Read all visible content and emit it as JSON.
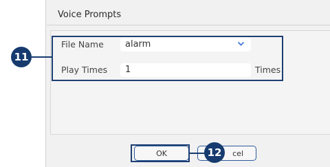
{
  "dialog": {
    "title": "Voice Prompts",
    "file_name_label": "File Name",
    "file_name_value": "alarm",
    "play_times_label": "Play Times",
    "play_times_value": "1",
    "play_times_suffix": "Times",
    "ok_label": "OK",
    "cancel_label_visible": "cel"
  },
  "callouts": {
    "first": "11",
    "second": "12"
  },
  "colors": {
    "callout": "#173b6f",
    "highlight": "#1d3f73",
    "dialog_bg": "#f1f1f1"
  },
  "icons": {
    "dropdown": "chevron-down-icon"
  }
}
